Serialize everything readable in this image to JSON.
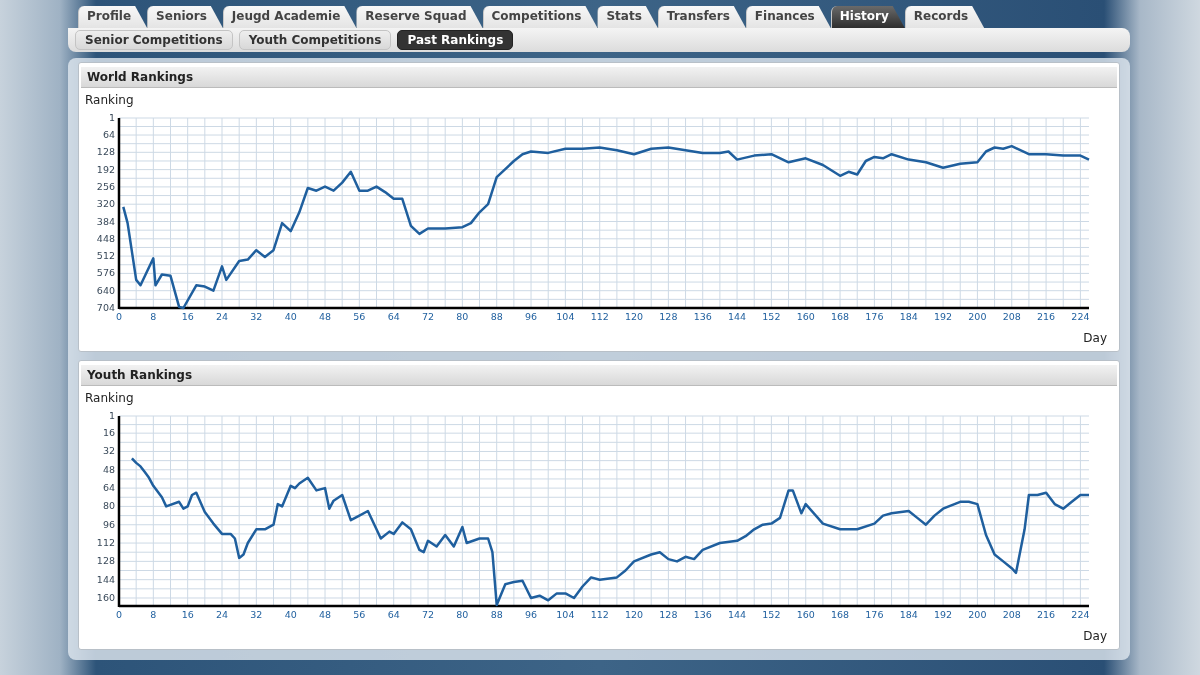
{
  "tabs": [
    {
      "label": "Profile",
      "selected": false
    },
    {
      "label": "Seniors",
      "selected": false
    },
    {
      "label": "Jeugd Academie",
      "selected": false
    },
    {
      "label": "Reserve Squad",
      "selected": false
    },
    {
      "label": "Competitions",
      "selected": false
    },
    {
      "label": "Stats",
      "selected": false
    },
    {
      "label": "Transfers",
      "selected": false
    },
    {
      "label": "Finances",
      "selected": false
    },
    {
      "label": "History",
      "selected": true
    },
    {
      "label": "Records",
      "selected": false
    }
  ],
  "subtabs": [
    {
      "label": "Senior Competitions",
      "selected": false
    },
    {
      "label": "Youth Competitions",
      "selected": false
    },
    {
      "label": "Past Rankings",
      "selected": true
    }
  ],
  "panels": [
    {
      "title": "World Rankings",
      "chart_data": {
        "type": "line",
        "grid": true,
        "ylabel": "Ranking",
        "xlabel": "Day",
        "xlim": [
          0,
          226
        ],
        "ylim": [
          704,
          1
        ],
        "xticks": [
          0,
          8,
          16,
          24,
          32,
          40,
          48,
          56,
          64,
          72,
          80,
          88,
          96,
          104,
          112,
          120,
          128,
          136,
          144,
          152,
          160,
          168,
          176,
          184,
          192,
          200,
          208,
          216,
          224
        ],
        "yticks": [
          1,
          64,
          128,
          192,
          256,
          320,
          384,
          448,
          512,
          576,
          640,
          704
        ],
        "x": [
          1,
          2,
          4,
          5,
          8,
          8.5,
          10,
          12,
          14,
          15,
          18,
          20,
          22,
          24,
          25,
          28,
          30,
          32,
          34,
          36,
          38,
          40,
          42,
          44,
          46,
          48,
          50,
          52,
          54,
          56,
          58,
          60,
          62,
          64,
          66,
          68,
          70,
          72,
          76,
          80,
          82,
          84,
          86,
          88,
          90,
          92,
          94,
          96,
          100,
          104,
          108,
          112,
          116,
          120,
          124,
          128,
          132,
          136,
          140,
          142,
          144,
          148,
          152,
          156,
          160,
          164,
          168,
          170,
          172,
          174,
          176,
          178,
          180,
          184,
          188,
          192,
          196,
          200,
          202,
          204,
          206,
          208,
          212,
          216,
          220,
          224,
          226
        ],
        "series": [
          {
            "color": "#1f5f9e",
            "values": [
              330,
              390,
              600,
              620,
              520,
              620,
              580,
              585,
              700,
              704,
              620,
              625,
              640,
              550,
              600,
              530,
              525,
              490,
              515,
              490,
              390,
              420,
              350,
              260,
              270,
              255,
              270,
              240,
              200,
              270,
              270,
              255,
              275,
              300,
              300,
              400,
              430,
              410,
              410,
              405,
              390,
              350,
              320,
              220,
              190,
              160,
              135,
              125,
              130,
              115,
              115,
              110,
              120,
              135,
              115,
              110,
              120,
              130,
              130,
              125,
              155,
              140,
              135,
              165,
              150,
              175,
              215,
              200,
              210,
              160,
              145,
              150,
              135,
              155,
              165,
              185,
              170,
              165,
              125,
              110,
              115,
              105,
              135,
              135,
              140,
              140,
              155
            ]
          }
        ]
      }
    },
    {
      "title": "Youth Rankings",
      "chart_data": {
        "type": "line",
        "grid": true,
        "ylabel": "Ranking",
        "xlabel": "Day",
        "xlim": [
          0,
          226
        ],
        "ylim": [
          167,
          1
        ],
        "xticks": [
          0,
          8,
          16,
          24,
          32,
          40,
          48,
          56,
          64,
          72,
          80,
          88,
          96,
          104,
          112,
          120,
          128,
          136,
          144,
          152,
          160,
          168,
          176,
          184,
          192,
          200,
          208,
          216,
          224
        ],
        "yticks": [
          1,
          16,
          32,
          48,
          64,
          80,
          96,
          112,
          128,
          144,
          160
        ],
        "x": [
          3,
          4,
          5,
          6,
          7,
          8,
          10,
          11,
          14,
          15,
          16,
          17,
          18,
          20,
          22,
          24,
          26,
          27,
          28,
          29,
          30,
          32,
          34,
          36,
          37,
          38,
          40,
          41,
          42,
          44,
          46,
          48,
          49,
          50,
          52,
          54,
          56,
          58,
          60,
          61,
          63,
          64,
          66,
          68,
          70,
          71,
          72,
          74,
          76,
          78,
          80,
          81,
          84,
          86,
          87,
          88,
          90,
          92,
          94,
          96,
          98,
          100,
          102,
          104,
          106,
          108,
          110,
          112,
          116,
          118,
          120,
          124,
          126,
          128,
          130,
          132,
          134,
          136,
          140,
          144,
          146,
          148,
          150,
          152,
          154,
          156,
          157,
          159,
          160,
          164,
          168,
          172,
          176,
          178,
          180,
          184,
          186,
          188,
          190,
          192,
          196,
          198,
          200,
          202,
          204,
          206,
          208,
          209,
          211,
          212,
          214,
          216,
          218,
          220,
          222,
          224,
          226
        ],
        "series": [
          {
            "color": "#1f5f9e",
            "values": [
              38,
              42,
              45,
              50,
              55,
              62,
              72,
              80,
              76,
              82,
              80,
              70,
              68,
              85,
              95,
              104,
              104,
              108,
              125,
              122,
              112,
              100,
              100,
              96,
              78,
              80,
              62,
              64,
              60,
              55,
              66,
              64,
              82,
              75,
              70,
              92,
              88,
              84,
              100,
              108,
              102,
              104,
              94,
              100,
              118,
              120,
              110,
              115,
              105,
              115,
              98,
              112,
              108,
              108,
              120,
              166,
              148,
              146,
              145,
              160,
              158,
              162,
              156,
              156,
              160,
              150,
              142,
              144,
              142,
              136,
              128,
              122,
              120,
              126,
              128,
              124,
              126,
              118,
              112,
              110,
              106,
              100,
              96,
              95,
              90,
              66,
              66,
              86,
              78,
              95,
              100,
              100,
              95,
              88,
              86,
              84,
              90,
              96,
              88,
              82,
              76,
              76,
              78,
              105,
              122,
              128,
              134,
              138,
              100,
              70,
              70,
              68,
              78,
              82,
              76,
              70,
              70
            ]
          }
        ]
      }
    }
  ]
}
